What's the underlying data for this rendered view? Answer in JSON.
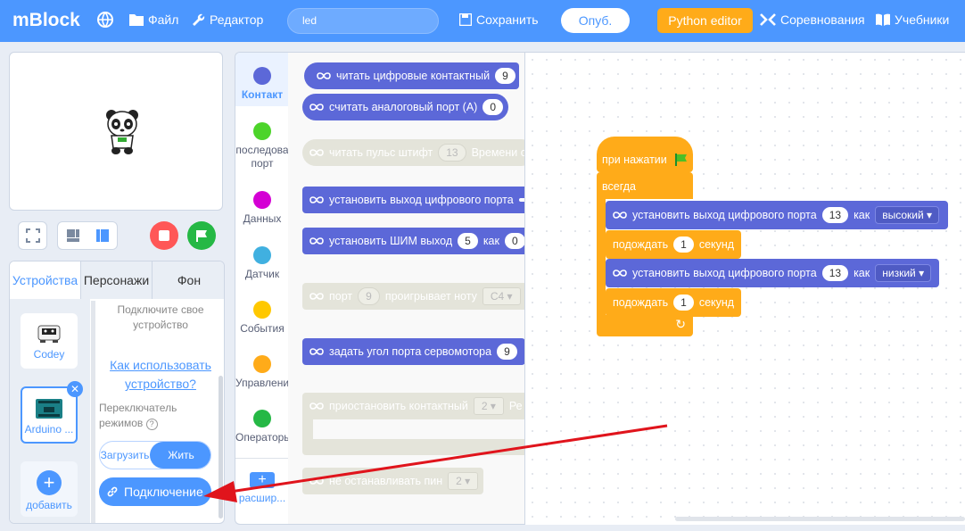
{
  "app": {
    "title": "mBlock"
  },
  "topbar": {
    "file": "Файл",
    "edit": "Редактор",
    "project_name": "led",
    "save": "Сохранить",
    "publish": "Опуб.",
    "python_editor": "Python editor",
    "competitions": "Соревнования",
    "tutorials": "Учебники"
  },
  "device_panel": {
    "tabs": [
      "Устройства",
      "Персонажи",
      "Фон"
    ],
    "devices": [
      {
        "name": "Codey"
      },
      {
        "name": "Arduino ..."
      }
    ],
    "add_label": "добавить",
    "connect_hint": "Подключите свое устройство",
    "how_to_link": "Как использовать устройство?",
    "mode_switch_label": "Переключатель режимов",
    "mode_upload": "Загрузить",
    "mode_live": "Жить",
    "connect_button": "Подключение"
  },
  "categories": [
    {
      "label": "Контакт",
      "color": "#5c68d8"
    },
    {
      "label": "последова порт",
      "color": "#4cd42a"
    },
    {
      "label": "Данных",
      "color": "#d400d4"
    },
    {
      "label": "Датчик",
      "color": "#40b0e0"
    },
    {
      "label": "События",
      "color": "#ffc800"
    },
    {
      "label": "Управлени",
      "color": "#ffab19"
    },
    {
      "label": "Операторы",
      "color": "#25b845"
    }
  ],
  "extension_label": "расшир...",
  "palette": {
    "b1": {
      "text": "читать цифровые контактный",
      "value": "9"
    },
    "b2": {
      "text": "считать аналоговый порт  (A)",
      "value": "0"
    },
    "b3": {
      "text": "читать пульс штифт",
      "value": "13",
      "text2": "Времени с"
    },
    "b4": {
      "text": "установить выход цифрового порта"
    },
    "b5": {
      "text": "установить ШИМ выход",
      "value": "5",
      "text2": "как",
      "value2": "0"
    },
    "b6": {
      "text": "порт",
      "value": "9",
      "text2": "проигрывает ноту",
      "note": "C4"
    },
    "b7": {
      "text": "задать угол порта сервомотора",
      "value": "9"
    },
    "b8": {
      "text": "приостановить контактный",
      "value": "2",
      "text2": "Ре"
    },
    "b9": {
      "text": "не останавливать пин",
      "value": "2"
    }
  },
  "script": {
    "hat": "при нажатии",
    "forever": "всегда",
    "s1": {
      "text": "установить выход цифрового порта",
      "pin": "13",
      "as": "как",
      "level": "высокий"
    },
    "w1": {
      "text": "подождать",
      "value": "1",
      "unit": "секунд"
    },
    "s2": {
      "text": "установить выход цифрового порта",
      "pin": "13",
      "as": "как",
      "level": "низкий"
    },
    "w2": {
      "text": "подождать",
      "value": "1",
      "unit": "секунд"
    }
  },
  "colors": {
    "accent": "#4c97ff",
    "arduino_block": "#5c68d8",
    "control": "#ffab19",
    "annotation_arrow": "#e0141c"
  }
}
